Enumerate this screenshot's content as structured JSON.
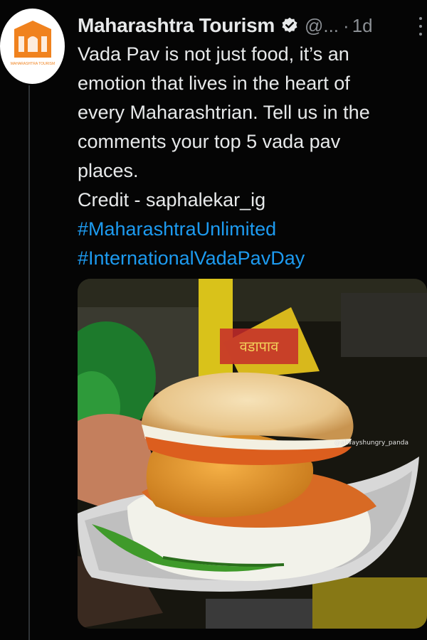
{
  "account": {
    "display_name": "Maharashtra Tourism",
    "handle": "@...",
    "separator": "·",
    "timestamp": "1d",
    "avatar_caption": "MAHARASHTRA TOURISM"
  },
  "tweet": {
    "text_lines": [
      "Vada Pav is not just food, it’s an",
      "emotion that lives in the heart of",
      "every Maharashtrian. Tell us in the",
      "comments your top 5 vada pav",
      "places.",
      "Credit - saphalekar_ig"
    ],
    "hashtags": [
      "#MaharashtraUnlimited",
      "#InternationalVadaPavDay"
    ]
  },
  "media": {
    "watermark": "@alwayshungry_panda",
    "sign_text": "वडापाव"
  },
  "colors": {
    "background": "#050505",
    "text": "#e7e9ea",
    "secondary": "#8b8f94",
    "link": "#1d9bf0",
    "brand_orange": "#f0821e"
  },
  "icons": {
    "verified": "verified-badge-icon",
    "more": "more-options-icon"
  }
}
